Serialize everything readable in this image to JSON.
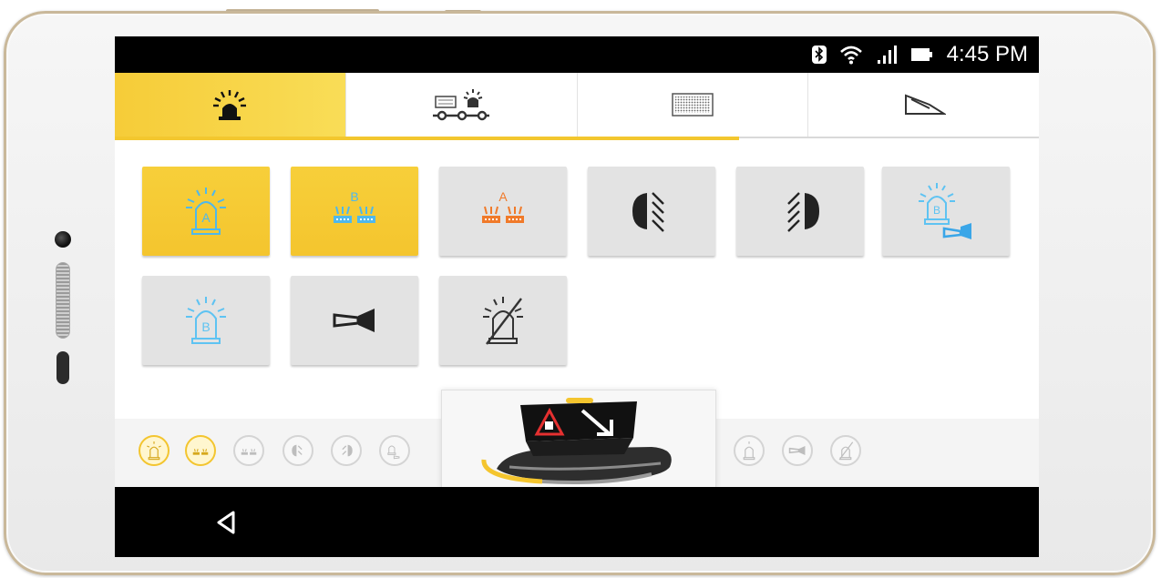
{
  "status_bar": {
    "time": "4:45 PM",
    "icons": [
      "bluetooth-icon",
      "wifi-icon",
      "signal-icon",
      "battery-icon"
    ]
  },
  "tabs": [
    {
      "icon": "beacon-icon",
      "active": true
    },
    {
      "icon": "trailer-beacon-icon",
      "active": false
    },
    {
      "icon": "message-board-icon",
      "active": false
    },
    {
      "icon": "ramp-icon",
      "active": false
    }
  ],
  "tiles": [
    {
      "id": "beacon-a",
      "icon": "beacon-a-icon",
      "label": "A",
      "on": true
    },
    {
      "id": "flash-b",
      "icon": "flashers-b-icon",
      "label": "B",
      "on": true
    },
    {
      "id": "flash-a",
      "icon": "flashers-a-icon",
      "label": "A",
      "on": false
    },
    {
      "id": "headlight-left",
      "icon": "headlight-left-icon",
      "label": "",
      "on": false
    },
    {
      "id": "headlight-right",
      "icon": "headlight-right-icon",
      "label": "",
      "on": false
    },
    {
      "id": "beacon-b-horn",
      "icon": "beacon-b-horn-icon",
      "label": "B",
      "on": false
    },
    {
      "id": "beacon-b",
      "icon": "beacon-b-icon",
      "label": "B",
      "on": false
    },
    {
      "id": "horn",
      "icon": "horn-icon",
      "label": "",
      "on": false
    },
    {
      "id": "all-off",
      "icon": "beacon-off-icon",
      "label": "",
      "on": false
    }
  ],
  "colors": {
    "accent": "#f4c52e",
    "blue_icon": "#5ec3f2",
    "orange_icon": "#f07a2a",
    "tile_off": "#e3e3e3"
  }
}
